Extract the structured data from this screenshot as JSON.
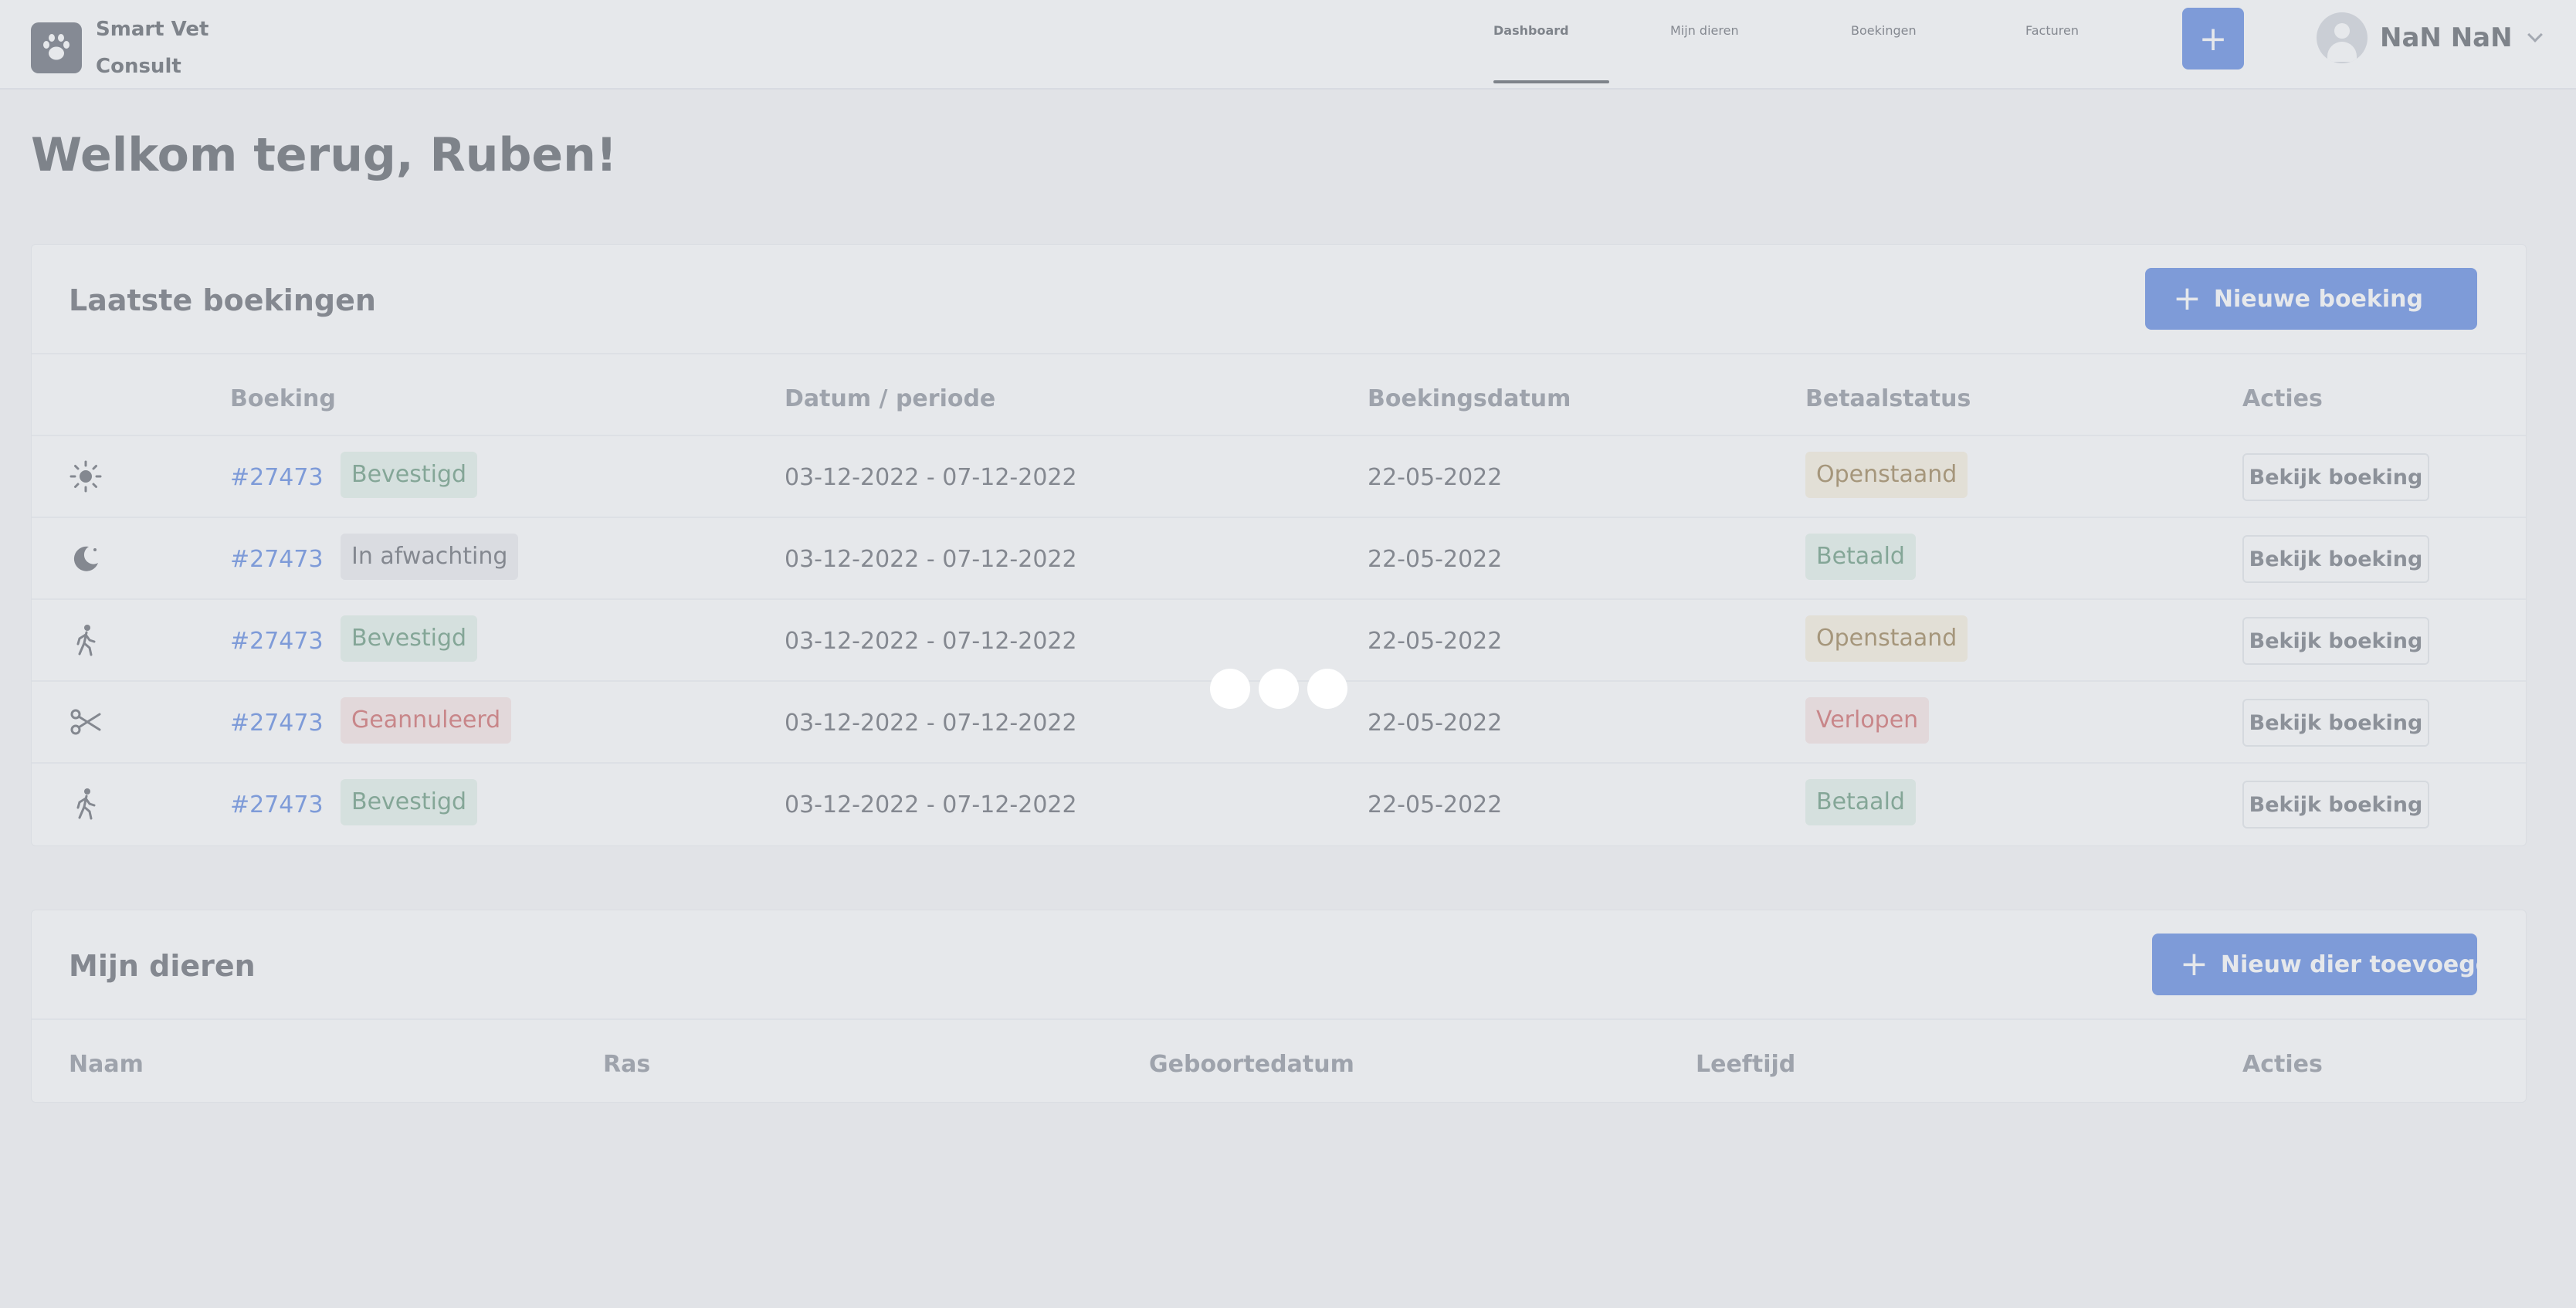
{
  "brand": {
    "name_line1": "Smart Vet",
    "name_line2": "Consult",
    "icon": "paw-icon"
  },
  "nav": {
    "items": [
      {
        "label": "Dashboard",
        "active": true
      },
      {
        "label": "Mijn dieren",
        "active": false
      },
      {
        "label": "Boekingen",
        "active": false
      },
      {
        "label": "Facturen",
        "active": false
      }
    ],
    "add_label": "+"
  },
  "user": {
    "name": "NaN NaN",
    "icon": "user-avatar-icon"
  },
  "page": {
    "title": "Welkom terug, Ruben!"
  },
  "bookings": {
    "title": "Laatste boekingen",
    "new_button": "Nieuwe boeking",
    "columns": [
      "Boeking",
      "Datum / periode",
      "Boekingsdatum",
      "Betaalstatus",
      "Acties"
    ],
    "rows": [
      {
        "icon": "sun-icon",
        "id": "#27473",
        "status": "Bevestigd",
        "status_kind": "green",
        "period": "03-12-2022 - 07-12-2022",
        "booking_date": "22-05-2022",
        "payment": "Openstaand",
        "payment_kind": "amber",
        "action": "Bekijk boeking"
      },
      {
        "icon": "moon-icon",
        "id": "#27473",
        "status": "In afwachting",
        "status_kind": "grey",
        "period": "03-12-2022 - 07-12-2022",
        "booking_date": "22-05-2022",
        "payment": "Betaald",
        "payment_kind": "green",
        "action": "Bekijk boeking"
      },
      {
        "icon": "walking-icon",
        "id": "#27473",
        "status": "Bevestigd",
        "status_kind": "green",
        "period": "03-12-2022 - 07-12-2022",
        "booking_date": "22-05-2022",
        "payment": "Openstaand",
        "payment_kind": "amber",
        "action": "Bekijk boeking"
      },
      {
        "icon": "scissors-icon",
        "id": "#27473",
        "status": "Geannuleerd",
        "status_kind": "red",
        "period": "03-12-2022 - 07-12-2022",
        "booking_date": "22-05-2022",
        "payment": "Verlopen",
        "payment_kind": "red",
        "action": "Bekijk boeking"
      },
      {
        "icon": "walking-icon",
        "id": "#27473",
        "status": "Bevestigd",
        "status_kind": "green",
        "period": "03-12-2022 - 07-12-2022",
        "booking_date": "22-05-2022",
        "payment": "Betaald",
        "payment_kind": "green",
        "action": "Bekijk boeking"
      }
    ]
  },
  "pets": {
    "title": "Mijn dieren",
    "new_button": "Nieuw dier toevoegen",
    "columns": [
      "Naam",
      "Ras",
      "Geboortedatum",
      "Leeftijd",
      "Acties"
    ]
  },
  "loading": {
    "icon": "loading-dots-icon"
  },
  "colors": {
    "accent": "#2e64d9",
    "text": "#2f343d",
    "background": "#f4f5f7"
  }
}
